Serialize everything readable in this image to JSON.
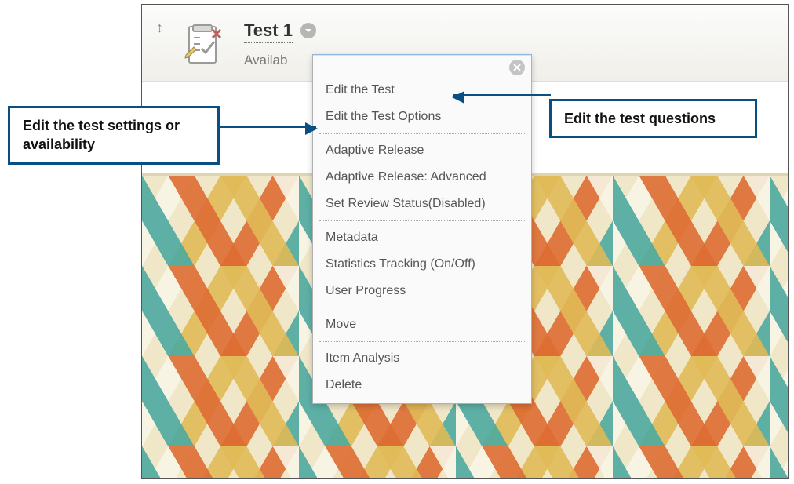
{
  "row": {
    "title": "Test 1",
    "availability_label": "Availab"
  },
  "menu": {
    "groups": [
      [
        "Edit the Test",
        "Edit the Test Options"
      ],
      [
        "Adaptive Release",
        "Adaptive Release: Advanced",
        "Set Review Status(Disabled)"
      ],
      [
        "Metadata",
        "Statistics Tracking (On/Off)",
        "User Progress"
      ],
      [
        "Move"
      ],
      [
        "Item Analysis",
        "Delete"
      ]
    ]
  },
  "callouts": {
    "left": "Edit the test settings or availability",
    "right": "Edit the test questions"
  }
}
